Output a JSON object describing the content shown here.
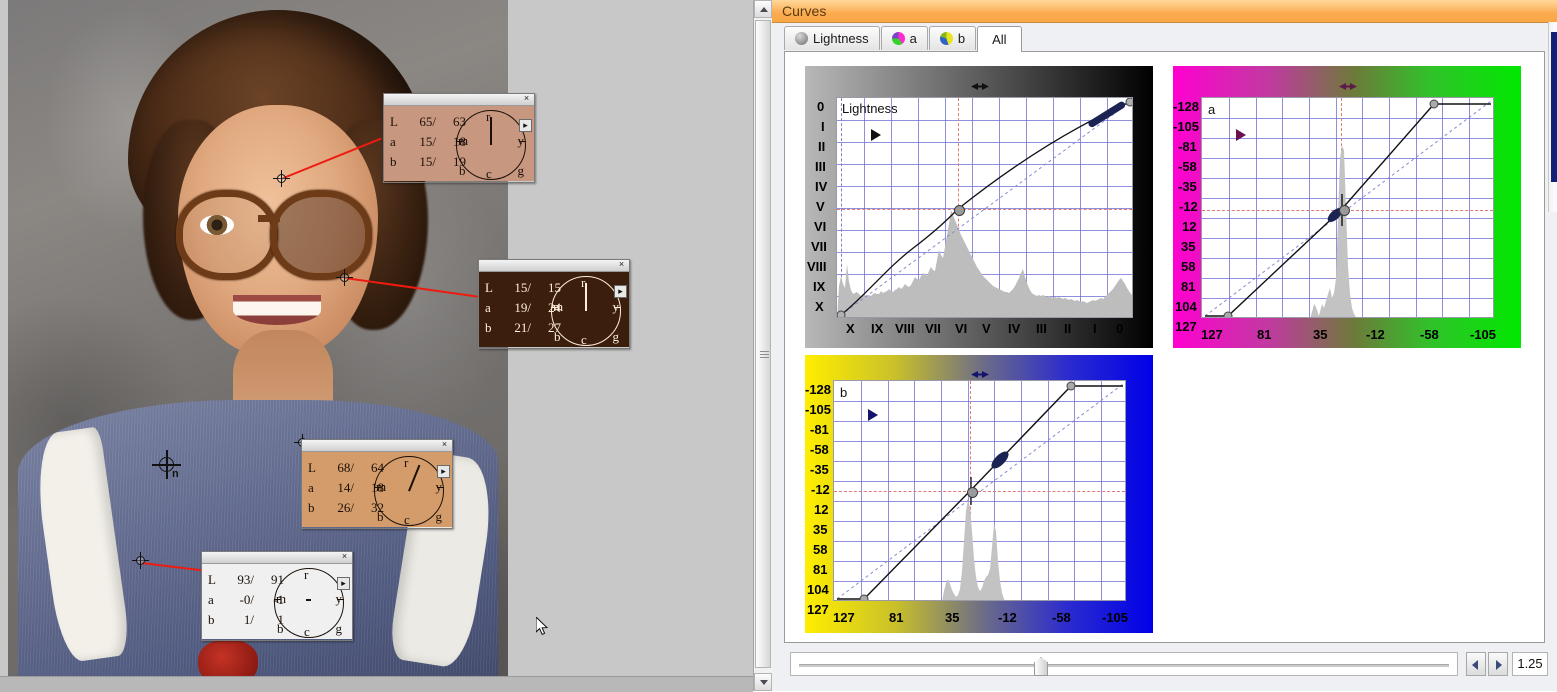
{
  "window": {
    "title": "Curves",
    "title_bar_color": "#f9a845"
  },
  "tabs": [
    {
      "label": "Lightness",
      "icon": "lightness-swatch-icon",
      "icon_color": "#8c8c8c",
      "selected": false
    },
    {
      "label": "a",
      "icon": "a-channel-swatch-icon",
      "icon_color": "#e040b0",
      "selected": false
    },
    {
      "label": "b",
      "icon": "b-channel-swatch-icon",
      "icon_color": "#d8d020",
      "selected": false
    },
    {
      "label": "All",
      "icon": "",
      "icon_color": "",
      "selected": true
    }
  ],
  "panels": [
    {
      "id": "lightness",
      "channel_label": "Lightness",
      "gradient": "grayscale",
      "gradient_from": "#b0b0b0",
      "gradient_to": "#000000",
      "y_ticks": [
        "0",
        "I",
        "II",
        "III",
        "IV",
        "V",
        "VI",
        "VII",
        "VIII",
        "IX",
        "X"
      ],
      "x_ticks": [
        "X",
        "IX",
        "VIII",
        "VII",
        "VI",
        "V",
        "IV",
        "III",
        "II",
        "I",
        "0"
      ],
      "tick_color": "#111111",
      "marker_color": "#111111"
    },
    {
      "id": "a",
      "channel_label": "a",
      "gradient": "magenta-green",
      "gradient_from": "#ff00d0",
      "gradient_to": "#00e000",
      "y_ticks": [
        "-128",
        "-105",
        "-81",
        "-58",
        "-35",
        "-12",
        "12",
        "35",
        "58",
        "81",
        "104",
        "127"
      ],
      "x_ticks": [
        "127",
        "81",
        "35",
        "-12",
        "-58",
        "-105"
      ],
      "tick_color": "#111111",
      "marker_color": "#6b1050"
    },
    {
      "id": "b",
      "channel_label": "b",
      "gradient": "yellow-blue",
      "gradient_from": "#ffee00",
      "gradient_to": "#0000e8",
      "y_ticks": [
        "-128",
        "-105",
        "-81",
        "-58",
        "-35",
        "-12",
        "12",
        "35",
        "58",
        "81",
        "104",
        "127"
      ],
      "x_ticks": [
        "127",
        "81",
        "35",
        "-12",
        "-58",
        "-105"
      ],
      "tick_color": "#111111",
      "marker_color": "#14146e"
    }
  ],
  "chart_data": [
    {
      "id": "lightness",
      "type": "line",
      "title": "Lightness",
      "xlabel": "",
      "ylabel": "",
      "xlim": [
        0,
        100
      ],
      "ylim": [
        0,
        100
      ],
      "x_ticks": [
        "X",
        "IX",
        "VIII",
        "VII",
        "VI",
        "V",
        "IV",
        "III",
        "II",
        "I",
        "0"
      ],
      "y_ticks": [
        "0",
        "I",
        "II",
        "III",
        "IV",
        "V",
        "VI",
        "VII",
        "VIII",
        "IX",
        "X"
      ],
      "grid": true,
      "legend": "none",
      "curve_points": [
        [
          0,
          0
        ],
        [
          18,
          22
        ],
        [
          50,
          56
        ],
        [
          88,
          92
        ],
        [
          100,
          100
        ]
      ],
      "identity_line": true,
      "control_point": {
        "x": 45,
        "y": 50
      },
      "crosshair": {
        "x": 45,
        "y": 50
      },
      "histogram": [
        8,
        14,
        11,
        9,
        22,
        12,
        8,
        7,
        6,
        6,
        7,
        6,
        5,
        6,
        5,
        5,
        6,
        5,
        6,
        7,
        6,
        6,
        8,
        7,
        7,
        8,
        9,
        8,
        7,
        8,
        9,
        10,
        9,
        10,
        12,
        11,
        10,
        11,
        14,
        17,
        16,
        15,
        18,
        20,
        19,
        18,
        21,
        24,
        22,
        21,
        28,
        34,
        31,
        29,
        36,
        44,
        52,
        61,
        58,
        55,
        52,
        49,
        46,
        44,
        41,
        38,
        36,
        34,
        31,
        29,
        27,
        25,
        24,
        22,
        21,
        20,
        19,
        18,
        17,
        16,
        15,
        15,
        14,
        14,
        13,
        13,
        12,
        12,
        12,
        13,
        14,
        16,
        19,
        22,
        26,
        30,
        33,
        28,
        24,
        20
      ]
    },
    {
      "id": "a",
      "type": "line",
      "title": "a",
      "xlabel": "",
      "ylabel": "",
      "xlim": [
        127,
        -128
      ],
      "ylim": [
        -128,
        127
      ],
      "x_ticks": [
        "127",
        "81",
        "35",
        "-12",
        "-58",
        "-105"
      ],
      "y_ticks": [
        "-128",
        "-105",
        "-81",
        "-58",
        "-35",
        "-12",
        "12",
        "35",
        "58",
        "81",
        "104",
        "127"
      ],
      "grid": true,
      "legend": "none",
      "curve_points": [
        [
          0,
          0
        ],
        [
          8,
          0
        ],
        [
          8,
          2
        ],
        [
          48,
          50
        ],
        [
          82,
          97
        ],
        [
          90,
          100
        ],
        [
          100,
          100
        ]
      ],
      "identity_line": true,
      "control_point": {
        "x": 48,
        "y": 50
      },
      "crosshair": {
        "x": 48,
        "y": 50
      },
      "histogram_peak_at": 46
    },
    {
      "id": "b",
      "type": "line",
      "title": "b",
      "xlabel": "",
      "ylabel": "",
      "xlim": [
        127,
        -128
      ],
      "ylim": [
        -128,
        127
      ],
      "x_ticks": [
        "127",
        "81",
        "35",
        "-12",
        "-58",
        "-105"
      ],
      "y_ticks": [
        "-128",
        "-105",
        "-81",
        "-58",
        "-35",
        "-12",
        "12",
        "35",
        "58",
        "81",
        "104",
        "127"
      ],
      "grid": true,
      "legend": "none",
      "curve_points": [
        [
          0,
          0
        ],
        [
          10,
          0
        ],
        [
          10,
          2
        ],
        [
          46,
          50
        ],
        [
          88,
          97
        ],
        [
          94,
          100
        ],
        [
          100,
          100
        ]
      ],
      "identity_line": true,
      "control_point": {
        "x": 46,
        "y": 50
      },
      "crosshair": {
        "x": 46,
        "y": 50
      },
      "histogram_peak_at": 47
    }
  ],
  "slider": {
    "value": "1.25",
    "thumb_position_pct": 37,
    "left_arrow": "◄",
    "right_arrow": "►"
  },
  "readouts": [
    {
      "id": "forehead",
      "bg": "#c79780",
      "text_color": "#1a1008",
      "rows": [
        {
          "ch": "L",
          "before": "65/",
          "after": "63"
        },
        {
          "ch": "a",
          "before": "15/",
          "after": "18"
        },
        {
          "ch": "b",
          "before": "15/",
          "after": "19"
        }
      ],
      "wheel_labels": [
        "r",
        "y",
        "g",
        "c",
        "b",
        "m"
      ],
      "needle_angle_deg": 0,
      "needle_len": 28,
      "close_label": "×",
      "menu_label": "▸"
    },
    {
      "id": "hair-shadow",
      "bg": "#3b1f0c",
      "text_color": "#ffeedd",
      "rows": [
        {
          "ch": "L",
          "before": "15/",
          "after": "15"
        },
        {
          "ch": "a",
          "before": "19/",
          "after": "24"
        },
        {
          "ch": "b",
          "before": "21/",
          "after": "27"
        }
      ],
      "wheel_labels": [
        "r",
        "y",
        "g",
        "c",
        "b",
        "m"
      ],
      "needle_angle_deg": 0,
      "needle_len": 28,
      "close_label": "×",
      "menu_label": "▸"
    },
    {
      "id": "neck-skin",
      "bg": "#d49c6a",
      "text_color": "#1a1008",
      "rows": [
        {
          "ch": "L",
          "before": "68/",
          "after": "64"
        },
        {
          "ch": "a",
          "before": "14/",
          "after": "18"
        },
        {
          "ch": "b",
          "before": "26/",
          "after": "32"
        }
      ],
      "wheel_labels": [
        "r",
        "y",
        "g",
        "c",
        "b",
        "m"
      ],
      "needle_angle_deg": 22,
      "needle_len": 28,
      "close_label": "×",
      "menu_label": "▸"
    },
    {
      "id": "collar-white",
      "bg": "#f0f0f0",
      "text_color": "#1a1008",
      "rows": [
        {
          "ch": "L",
          "before": "93/",
          "after": "91"
        },
        {
          "ch": "a",
          "before": "-0/",
          "after": "-1"
        },
        {
          "ch": "b",
          "before": "1/",
          "after": "1"
        }
      ],
      "wheel_labels": [
        "r",
        "y",
        "g",
        "c",
        "b",
        "m"
      ],
      "needle_angle_deg": 0,
      "needle_len": 0,
      "close_label": "×",
      "menu_label": "▸"
    }
  ],
  "image_canvas": {
    "cursor_label": "n",
    "sample_marker_count": 4,
    "lead_line_color": "#ee1b10"
  }
}
